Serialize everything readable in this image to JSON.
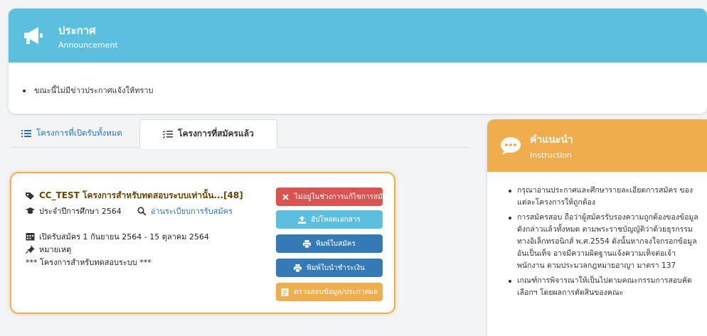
{
  "announcement": {
    "title_th": "ประกาศ",
    "title_en": "Announcement",
    "message": "ขณะนี้ไม่มีข่าวประกาศแจ้งให้ทราบ",
    "header_color": "#5bc0de"
  },
  "tabs": [
    {
      "label": "โครงการที่เปิดรับทั้งหมด",
      "icon": "list-icon",
      "active": false
    },
    {
      "label": "โครงการที่สมัครแล้ว",
      "icon": "checklist-icon",
      "active": true
    }
  ],
  "project_card": {
    "title": "CC_TEST โครงการสำหรับทดสอบระบบเท่านั้น...[48]",
    "academic_year_label": "ประจำปีการศึกษา",
    "academic_year": "2564",
    "rules_link": "อ่านระเบียบการรับสมัคร",
    "period": "เปิดรับสมัคร 1 กันยายน 2564 - 15 ตุลาคม 2564",
    "note_label": "หมายเหตุ",
    "note_text": "*** โครงการสำหรับทดสอบระบบ ***",
    "border_color": "#f0ad4e",
    "buttons": {
      "not_in_edit_period": "ไม่อยู่ในช่วงการแก้ไขการสมัคร",
      "upload_docs": "อัปโหลดเอกสาร",
      "print_application": "พิมพ์ใบสมัคร",
      "print_payment": "พิมพ์ใบนำชำระเงิน",
      "check_results": "ตรวจสอบข้อมูล/ประกาศผล"
    }
  },
  "instruction": {
    "title_th": "คำแนะนำ",
    "title_en": "Instruction",
    "header_color": "#f0ad4e",
    "items": [
      "กรุณาอ่านประกาศและศึกษารายละเอียดการสมัคร ของแต่ละโครงการให้ถูกต้อง",
      "การสมัครสอบ ถือว่าผู้สมัครรับรองความถูกต้องของข้อมูลดังกล่าวแล้วทั้งหมด ตามพระราชบัญญัติว่าด้วยธุรกรรมทางอิเล็กทรอนิกส์ พ.ศ.2554 ดังนั้นหากจงใจกรอกข้อมูลอันเป็นเท็จ อาจมีความผิดฐานแจ้งความเท็จต่อเจ้าพนักงาน ตามประมวลกฎหมายอาญา มาตรา 137",
      "เกณฑ์การพิจารณาให้เป็นไปตามคณะกรรมการสอบคัดเลือกฯ โดยผลการตัดสินของคณะ"
    ]
  }
}
